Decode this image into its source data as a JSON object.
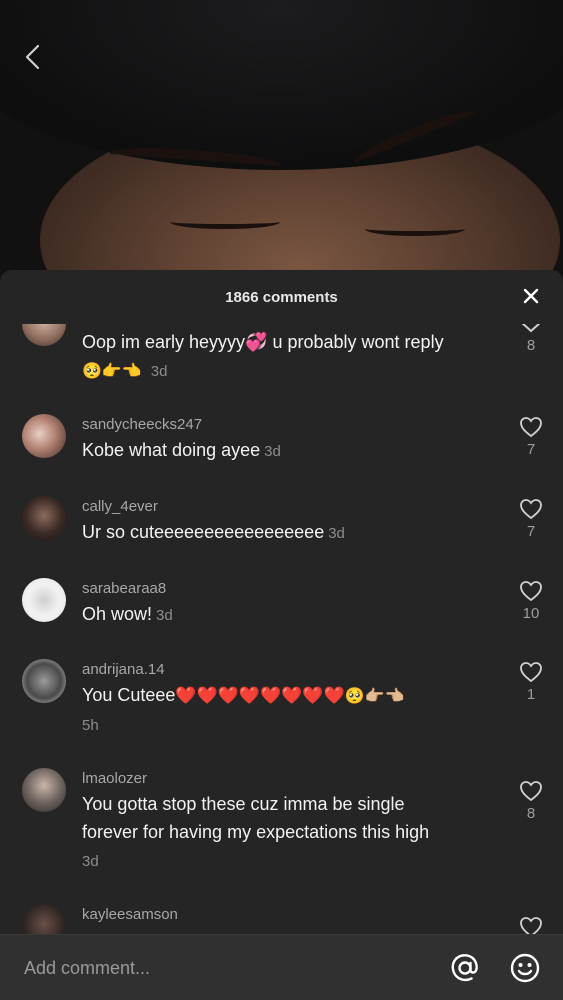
{
  "header": {
    "title": "1866 comments"
  },
  "comments": [
    {
      "username": "",
      "text": "Oop im early heyyyy💞 u probably wont reply",
      "text2": "🥺👉👈",
      "time": "3d",
      "likes": "8",
      "avatar_color": "#8a6a5a"
    },
    {
      "username": "sandycheecks247",
      "text": "Kobe what doing ayee",
      "time": "3d",
      "likes": "7",
      "avatar_color": "#7c5d54"
    },
    {
      "username": "cally_4ever",
      "text": "Ur so cuteeeeeeeeeeeeeeeee",
      "time": "3d",
      "likes": "7",
      "avatar_color": "#3a2a24"
    },
    {
      "username": "sarabearaa8",
      "text": "Oh wow!",
      "time": "3d",
      "likes": "10",
      "avatar_color": "#e9e9e9"
    },
    {
      "username": "andrijana.14",
      "text": "You Cuteee",
      "hearts": "❤️❤️❤️❤️❤️❤️❤️❤️",
      "text2": "🥺👉🏼👈🏼",
      "time": "5h",
      "likes": "1",
      "avatar_color": "#5a5a5a"
    },
    {
      "username": "lmaolozer",
      "text": "You gotta stop these cuz imma be single",
      "text_line2": "forever for having my expectations this high",
      "time": "3d",
      "likes": "8",
      "avatar_color": "#6e6460"
    },
    {
      "username": "kayleesamson",
      "text": "",
      "time": "",
      "likes": "",
      "avatar_color": "#2e2624"
    }
  ],
  "input": {
    "placeholder": "Add comment..."
  },
  "icons": {
    "back": "chevron-left-icon",
    "close": "close-icon",
    "like": "heart-outline-icon",
    "mention": "at-sign-icon",
    "emoji": "smiley-icon"
  }
}
